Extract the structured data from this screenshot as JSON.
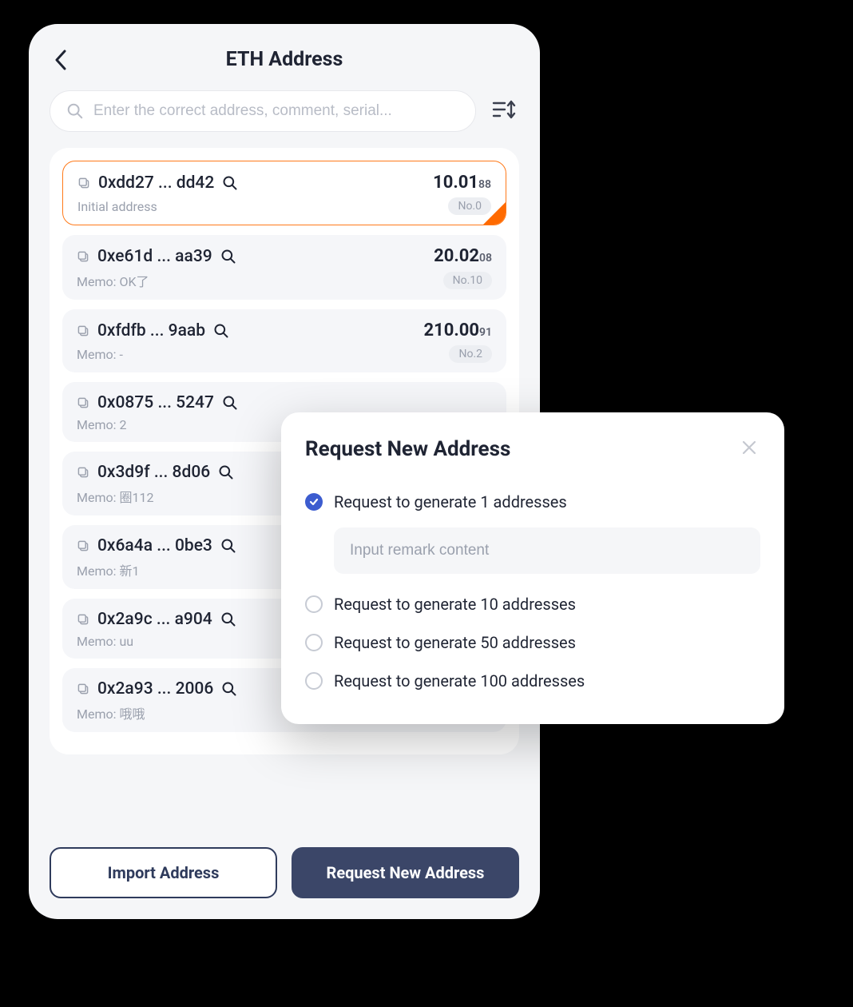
{
  "header": {
    "title": "ETH Address"
  },
  "search": {
    "placeholder": "Enter the correct address, comment, serial..."
  },
  "addresses": [
    {
      "addr": "0xdd27 ... dd42",
      "balance_main": "10.01",
      "balance_dec": "88",
      "memo": "Initial address",
      "no": "No.0",
      "selected": true
    },
    {
      "addr": "0xe61d ... aa39",
      "balance_main": "20.02",
      "balance_dec": "08",
      "memo": "Memo: OK了",
      "no": "No.10",
      "selected": false
    },
    {
      "addr": "0xfdfb ... 9aab",
      "balance_main": "210.00",
      "balance_dec": "91",
      "memo": "Memo: -",
      "no": "No.2",
      "selected": false
    },
    {
      "addr": "0x0875 ... 5247",
      "balance_main": "",
      "balance_dec": "",
      "memo": "Memo: 2",
      "no": "",
      "selected": false
    },
    {
      "addr": "0x3d9f ... 8d06",
      "balance_main": "",
      "balance_dec": "",
      "memo": "Memo: 圈112",
      "no": "",
      "selected": false
    },
    {
      "addr": "0x6a4a ... 0be3",
      "balance_main": "",
      "balance_dec": "",
      "memo": "Memo: 新1",
      "no": "",
      "selected": false
    },
    {
      "addr": "0x2a9c ... a904",
      "balance_main": "",
      "balance_dec": "",
      "memo": "Memo: uu",
      "no": "",
      "selected": false
    },
    {
      "addr": "0x2a93 ... 2006",
      "balance_main": "",
      "balance_dec": "",
      "memo": "Memo: 哦哦",
      "no": "",
      "selected": false
    }
  ],
  "buttons": {
    "import": "Import Address",
    "request": "Request New Address"
  },
  "modal": {
    "title": "Request New Address",
    "remark_placeholder": "Input remark content",
    "options": [
      {
        "label": "Request to generate 1 addresses",
        "checked": true
      },
      {
        "label": "Request to generate 10 addresses",
        "checked": false
      },
      {
        "label": "Request to generate 50 addresses",
        "checked": false
      },
      {
        "label": "Request to generate 100 addresses",
        "checked": false
      }
    ]
  }
}
